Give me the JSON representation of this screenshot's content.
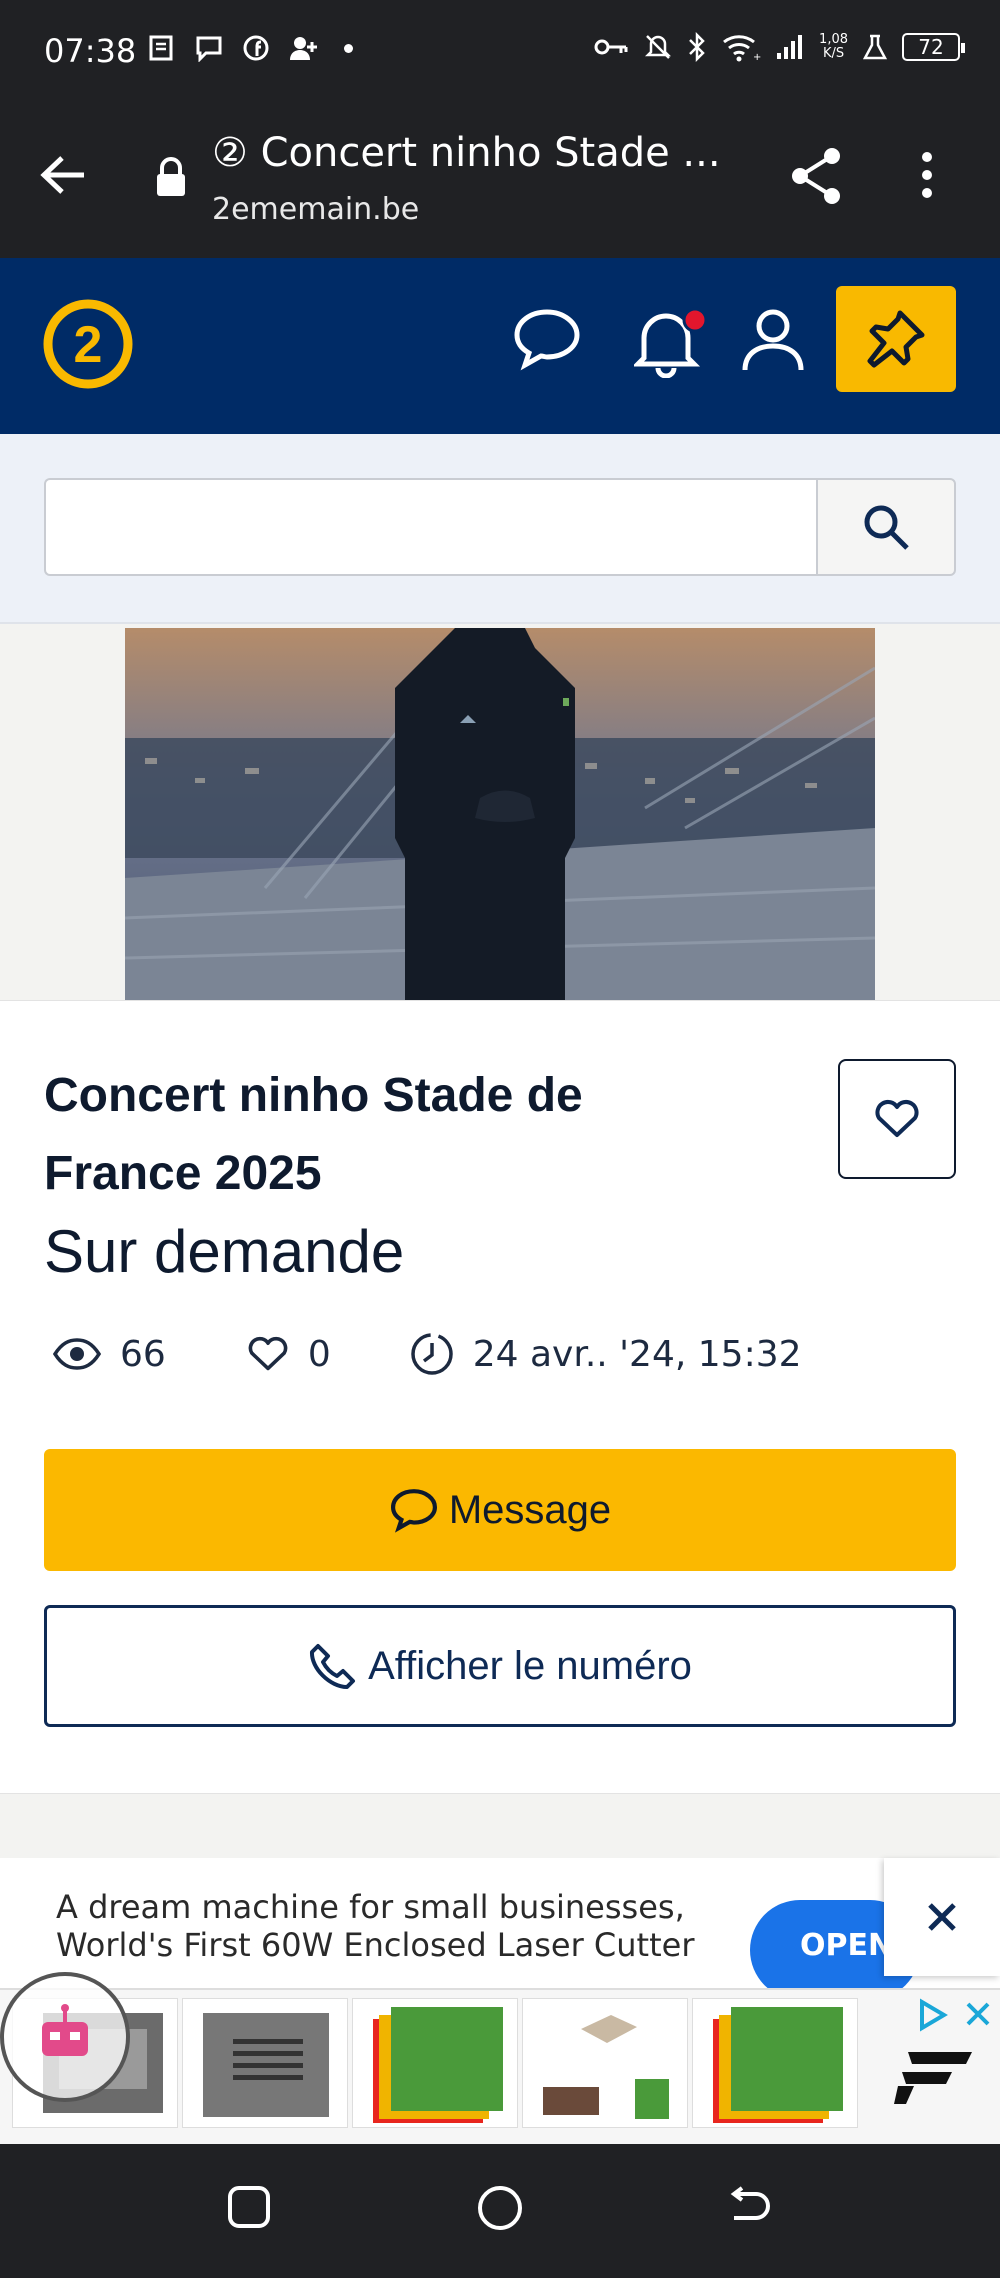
{
  "status_bar": {
    "time": "07:38",
    "speed": "1,08\nK/S",
    "battery": "72",
    "icons": [
      "news-icon",
      "chat-icon",
      "facebook-icon",
      "add-user-icon",
      "dot-icon",
      "key-icon",
      "mute-icon",
      "bluetooth-icon",
      "wifi-icon",
      "signal-icon",
      "lab-icon"
    ]
  },
  "browser": {
    "title": "② Concert ninho Stade ...",
    "domain": "2ememain.be"
  },
  "site": {
    "logo_text": "2",
    "brand_color": "#002b66",
    "accent_color": "#fbb800"
  },
  "search": {
    "value": "",
    "placeholder": ""
  },
  "listing": {
    "title": "Concert ninho Stade de France 2025",
    "price": "Sur demande",
    "views": "66",
    "favorites": "0",
    "date": "24 avr.. '24, 15:32",
    "message_label": "Message",
    "phone_label": "Afficher le numéro"
  },
  "ad": {
    "line1": "A dream machine for small businesses,",
    "line2": "World's First 60W Enclosed Laser Cutter",
    "cta": "OPEN"
  }
}
